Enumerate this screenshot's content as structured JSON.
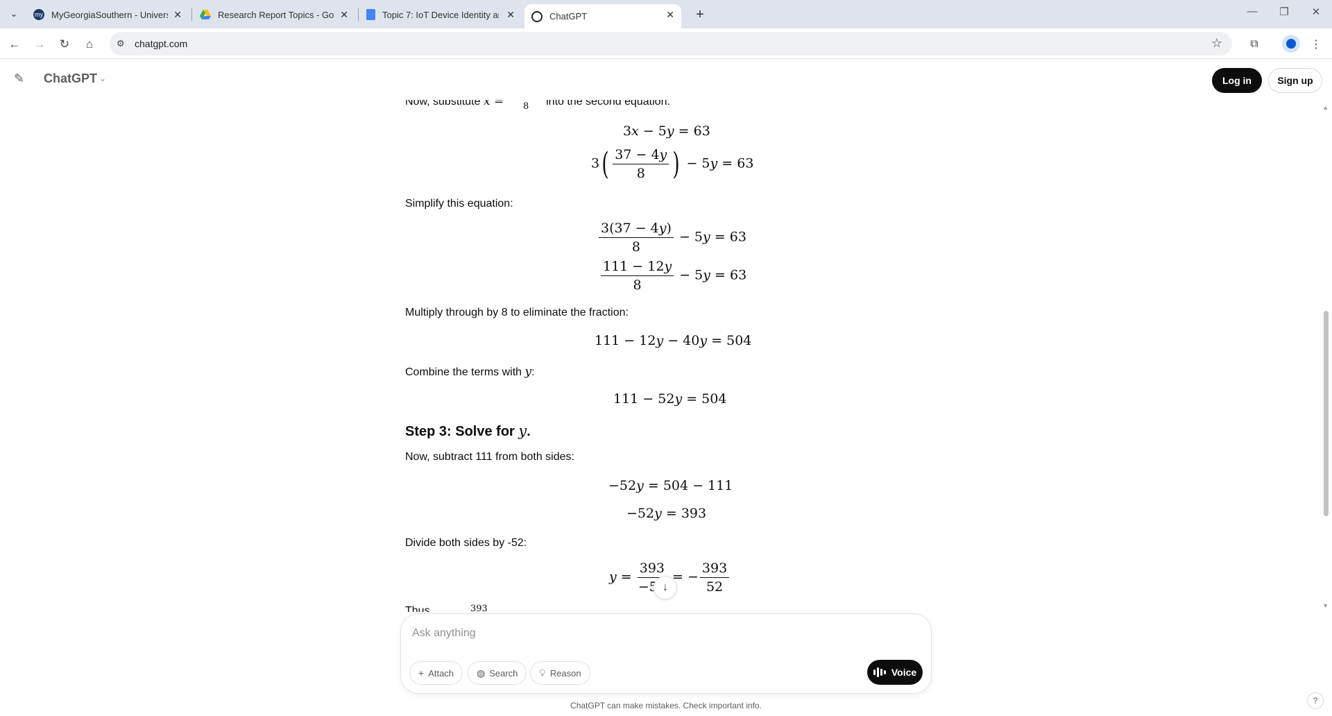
{
  "browser": {
    "tabs": [
      {
        "title": "MyGeorgiaSouthern - Universit",
        "favicon": "my-georgia-southern-icon",
        "favicon_text": "my",
        "active": false
      },
      {
        "title": "Research Report Topics - Googl",
        "favicon": "google-drive-icon",
        "active": false
      },
      {
        "title": "Topic 7: IoT Device Identity and",
        "favicon": "google-docs-icon",
        "active": false
      },
      {
        "title": "ChatGPT",
        "favicon": "chatgpt-icon",
        "active": true
      }
    ],
    "url": "chatgpt.com"
  },
  "header": {
    "model_name": "ChatGPT",
    "login_label": "Log in",
    "signup_label": "Sign up"
  },
  "conversation": {
    "partial_top_text": "Now, substitute",
    "partial_top_tail": "into the second equation:",
    "simplify_text": "Simplify this equation:",
    "multiply_text": "Multiply through by 8 to eliminate the fraction:",
    "combine_text": "Combine the terms with",
    "combine_var": "y",
    "step3_heading": "Step 3: Solve for",
    "step3_var": "y",
    "subtract_text": "Now, subtract 111 from both sides:",
    "divide_text": "Divide both sides by -52:",
    "partial_bottom_text": "Thus",
    "partial_bottom_num": "393"
  },
  "composer": {
    "placeholder": "Ask anything",
    "attach_label": "Attach",
    "search_label": "Search",
    "reason_label": "Reason",
    "voice_label": "Voice"
  },
  "footer": {
    "disclaimer": "ChatGPT can make mistakes. Check important info.",
    "help_label": "?"
  }
}
